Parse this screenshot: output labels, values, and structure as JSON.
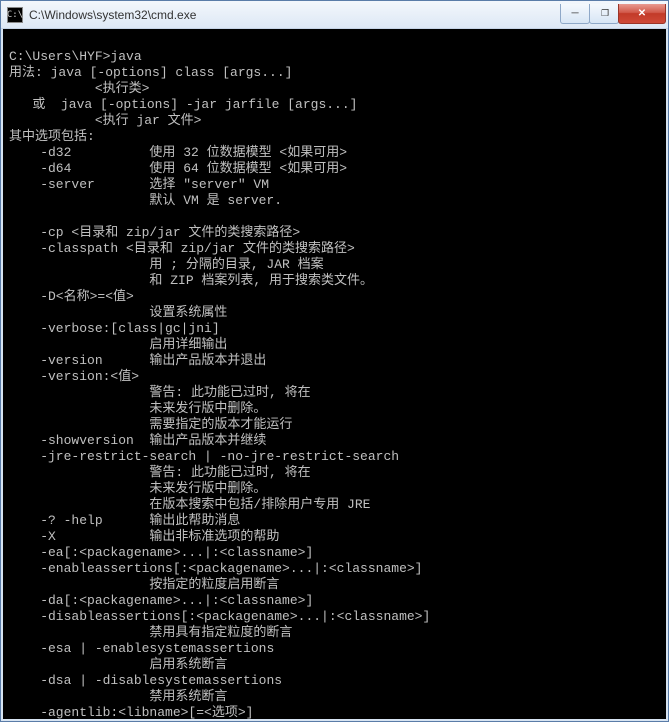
{
  "window": {
    "title_path": "C:\\Windows\\system32\\cmd.exe",
    "icon_text": "C:\\"
  },
  "buttons": {
    "min": "─",
    "restore": "❐",
    "close": "✕"
  },
  "terminal": {
    "lines": [
      "",
      "C:\\Users\\HYF>java",
      "用法: java [-options] class [args...]",
      "           <执行类>",
      "   或  java [-options] -jar jarfile [args...]",
      "           <执行 jar 文件>",
      "其中选项包括:",
      "    -d32          使用 32 位数据模型 <如果可用>",
      "    -d64          使用 64 位数据模型 <如果可用>",
      "    -server       选择 \"server\" VM",
      "                  默认 VM 是 server.",
      "",
      "    -cp <目录和 zip/jar 文件的类搜索路径>",
      "    -classpath <目录和 zip/jar 文件的类搜索路径>",
      "                  用 ; 分隔的目录, JAR 档案",
      "                  和 ZIP 档案列表, 用于搜索类文件。",
      "    -D<名称>=<值>",
      "                  设置系统属性",
      "    -verbose:[class|gc|jni]",
      "                  启用详细输出",
      "    -version      输出产品版本并退出",
      "    -version:<值>",
      "                  警告: 此功能已过时, 将在",
      "                  未来发行版中删除。",
      "                  需要指定的版本才能运行",
      "    -showversion  输出产品版本并继续",
      "    -jre-restrict-search | -no-jre-restrict-search",
      "                  警告: 此功能已过时, 将在",
      "                  未来发行版中删除。",
      "                  在版本搜索中包括/排除用户专用 JRE",
      "    -? -help      输出此帮助消息",
      "    -X            输出非标准选项的帮助",
      "    -ea[:<packagename>...|:<classname>]",
      "    -enableassertions[:<packagename>...|:<classname>]",
      "                  按指定的粒度启用断言",
      "    -da[:<packagename>...|:<classname>]",
      "    -disableassertions[:<packagename>...|:<classname>]",
      "                  禁用具有指定粒度的断言",
      "    -esa | -enablesystemassertions",
      "                  启用系统断言",
      "    -dsa | -disablesystemassertions",
      "                  禁用系统断言",
      "    -agentlib:<libname>[=<选项>]"
    ]
  }
}
